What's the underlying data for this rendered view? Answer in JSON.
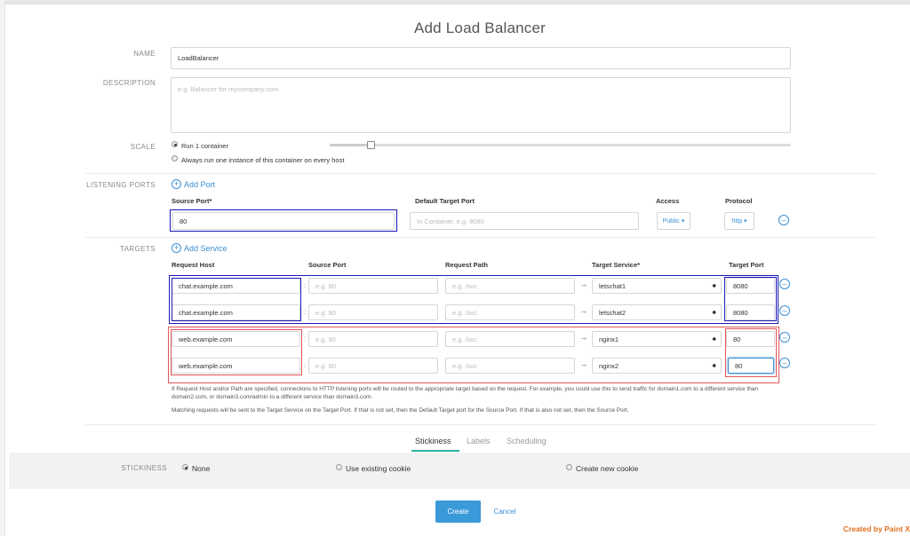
{
  "title": "Add Load Balancer",
  "name": {
    "label": "NAME",
    "value": "LoadBalancer"
  },
  "description": {
    "label": "DESCRIPTION",
    "placeholder": "e.g. Balancer for mycompany.com"
  },
  "scale": {
    "label": "SCALE",
    "option1": "Run 1 container",
    "option2": "Always run one instance of this container on every host",
    "selected": "option1"
  },
  "listening": {
    "label": "LISTENING PORTS",
    "add": "Add Port",
    "headers": {
      "source": "Source Port*",
      "default_target": "Default Target Port",
      "access": "Access",
      "protocol": "Protocol"
    },
    "row": {
      "source": "80",
      "default_target_placeholder": "In Container, e.g. 8080",
      "access": "Public",
      "protocol": "http"
    }
  },
  "targets": {
    "label": "TARGETS",
    "add": "Add Service",
    "headers": {
      "host": "Request Host",
      "source_port": "Source Port",
      "path": "Request Path",
      "service": "Target Service*",
      "port": "Target Port"
    },
    "source_port_placeholder": "e.g. 80",
    "path_placeholder": "e.g. /svc",
    "rows": [
      {
        "host": "chat.example.com",
        "service": "letschat1",
        "port": "8080"
      },
      {
        "host": "chat.example.com",
        "service": "letschat2",
        "port": "8080"
      },
      {
        "host": "web.example.com",
        "service": "nginx1",
        "port": "80"
      },
      {
        "host": "web.example.com",
        "service": "nginx2",
        "port": "80"
      }
    ],
    "help1": "If Request Host and/or Path are specified, connections to HTTP listening ports will be routed to the appropriate target based on the request. For example, you could use this to send traffic for domain1.com to a different service than domain2.com, or domain3.com/admin to a different service than domain3.com.",
    "help2": "Matching requests will be sent to the Target Service on the Target Port. If that is not set, then the Default Target port for the Source Port. If that is also not set, then the Source Port."
  },
  "tabs": [
    "Stickiness",
    "Labels",
    "Scheduling"
  ],
  "stickiness": {
    "label": "STICKINESS",
    "none": "None",
    "existing": "Use existing cookie",
    "new": "Create new cookie"
  },
  "actions": {
    "create": "Create",
    "cancel": "Cancel"
  },
  "watermark": "Created by Paint X",
  "colors": {
    "accent": "#3a8fd6",
    "highlight_blue": "#1a1ab8",
    "highlight_red": "#e05858",
    "tab_active": "#2bb3a0"
  }
}
